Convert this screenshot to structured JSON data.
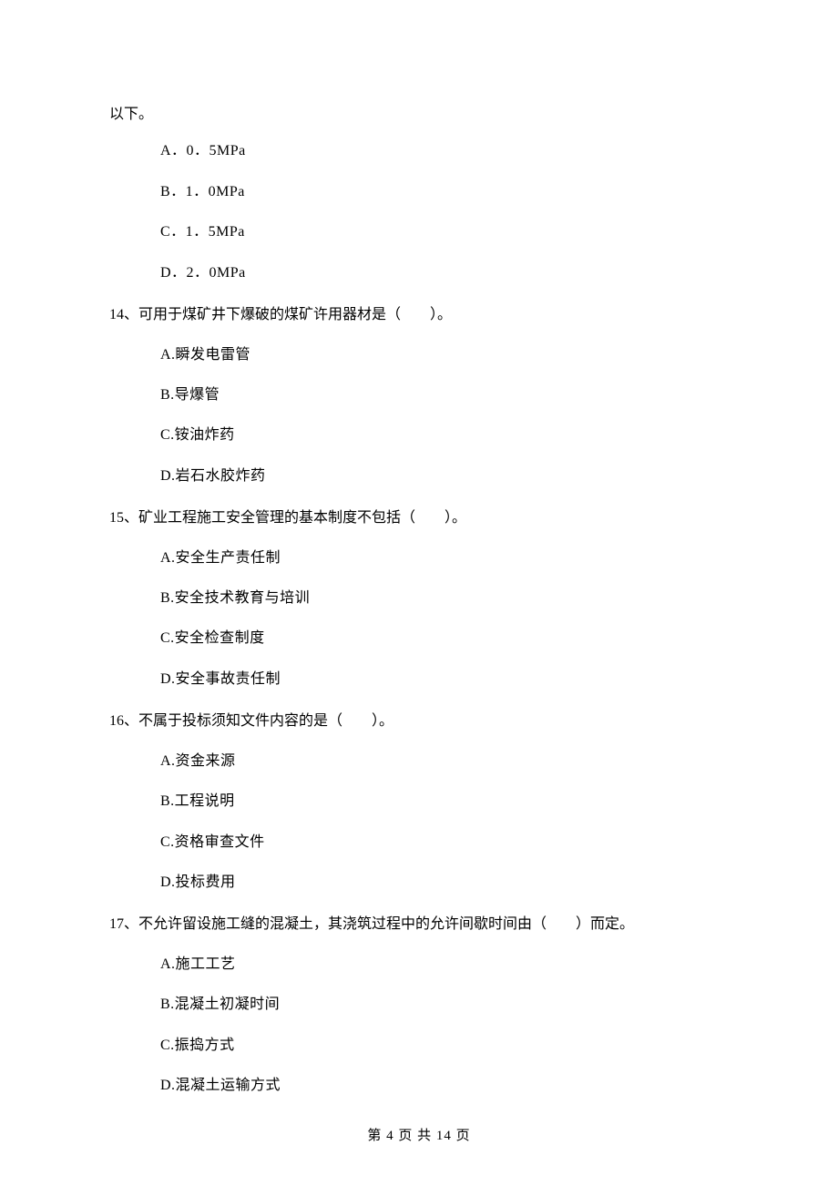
{
  "continuation_text": "以下。",
  "q13": {
    "options": [
      "A．0．5MPa",
      "B．1．0MPa",
      "C．1．5MPa",
      "D．2．0MPa"
    ]
  },
  "q14": {
    "stem": "14、可用于煤矿井下爆破的煤矿许用器材是（　　）。",
    "options": [
      "A.瞬发电雷管",
      "B.导爆管",
      "C.铵油炸药",
      "D.岩石水胶炸药"
    ]
  },
  "q15": {
    "stem": "15、矿业工程施工安全管理的基本制度不包括（　　）。",
    "options": [
      "A.安全生产责任制",
      "B.安全技术教育与培训",
      "C.安全检查制度",
      "D.安全事故责任制"
    ]
  },
  "q16": {
    "stem": "16、不属于投标须知文件内容的是（　　）。",
    "options": [
      "A.资金来源",
      "B.工程说明",
      "C.资格审查文件",
      "D.投标费用"
    ]
  },
  "q17": {
    "stem": "17、不允许留设施工缝的混凝土，其浇筑过程中的允许间歇时间由（　　）而定。",
    "options": [
      "A.施工工艺",
      "B.混凝土初凝时间",
      "C.振捣方式",
      "D.混凝土运输方式"
    ]
  },
  "footer": "第 4 页 共 14 页"
}
